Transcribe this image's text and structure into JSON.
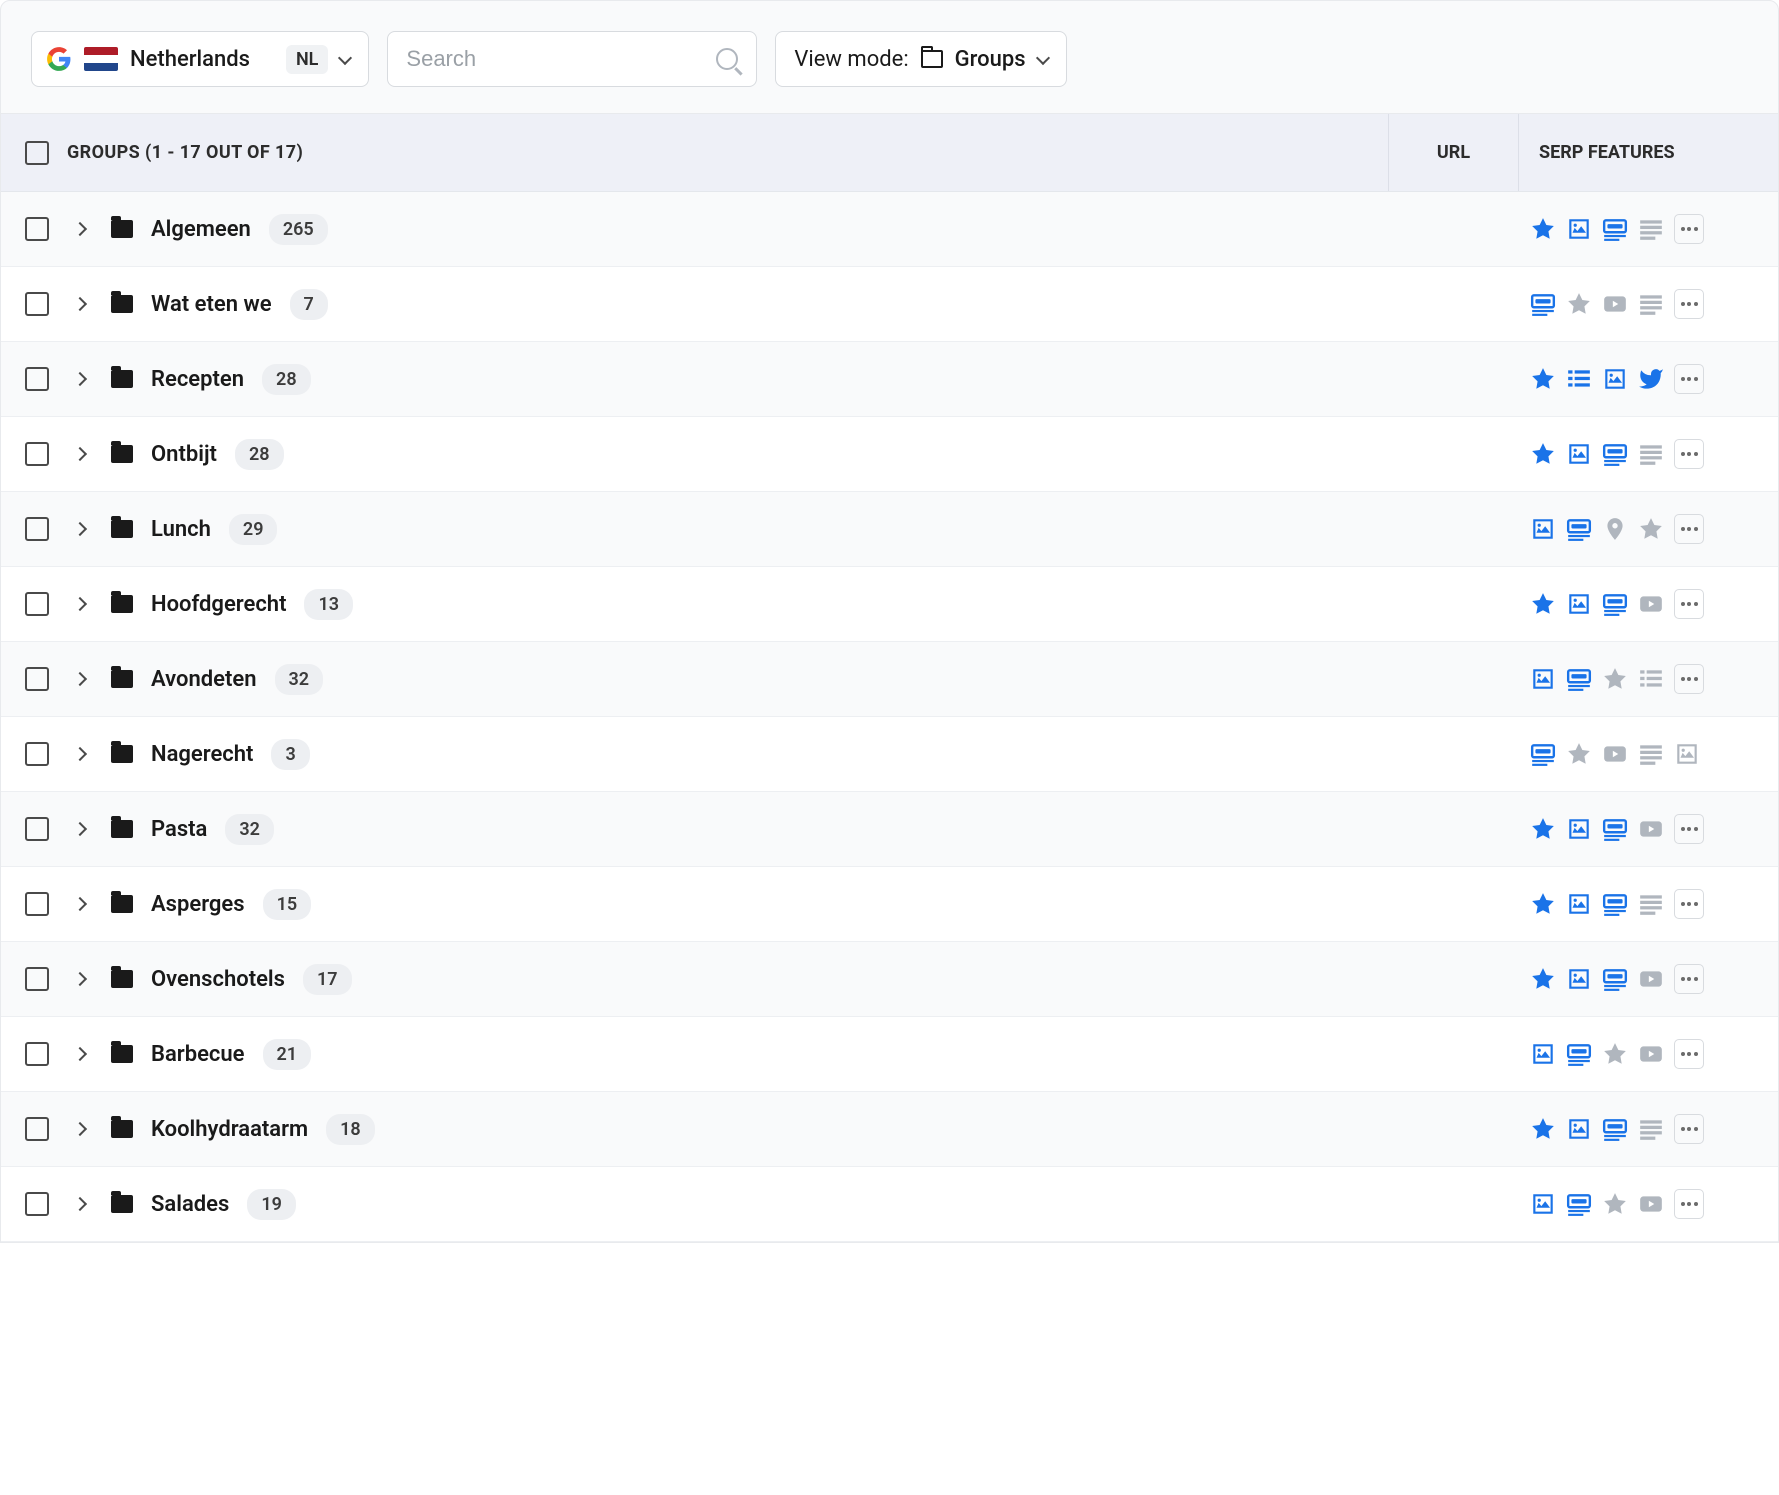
{
  "toolbar": {
    "country_name": "Netherlands",
    "country_code": "NL",
    "search_placeholder": "Search",
    "viewmode_label": "View mode:",
    "viewmode_value": "Groups"
  },
  "headers": {
    "groups": "GROUPS (1 - 17 OUT OF 17)",
    "url": "URL",
    "serp": "SERP FEATURES"
  },
  "rows": [
    {
      "name": "Algemeen",
      "count": "265",
      "features": [
        {
          "t": "star",
          "a": true
        },
        {
          "t": "image",
          "a": true
        },
        {
          "t": "card",
          "a": true
        },
        {
          "t": "lines",
          "a": false
        }
      ],
      "more": true
    },
    {
      "name": "Wat eten we",
      "count": "7",
      "features": [
        {
          "t": "card",
          "a": true
        },
        {
          "t": "star",
          "a": false
        },
        {
          "t": "video",
          "a": false
        },
        {
          "t": "lines",
          "a": false
        }
      ],
      "more": true
    },
    {
      "name": "Recepten",
      "count": "28",
      "features": [
        {
          "t": "star",
          "a": true
        },
        {
          "t": "list",
          "a": true
        },
        {
          "t": "image",
          "a": true
        },
        {
          "t": "twitter",
          "a": true
        }
      ],
      "more": true
    },
    {
      "name": "Ontbijt",
      "count": "28",
      "features": [
        {
          "t": "star",
          "a": true
        },
        {
          "t": "image",
          "a": true
        },
        {
          "t": "card",
          "a": true
        },
        {
          "t": "lines",
          "a": false
        }
      ],
      "more": true
    },
    {
      "name": "Lunch",
      "count": "29",
      "features": [
        {
          "t": "image",
          "a": true
        },
        {
          "t": "card",
          "a": true
        },
        {
          "t": "pin",
          "a": false
        },
        {
          "t": "star",
          "a": false
        }
      ],
      "more": true
    },
    {
      "name": "Hoofdgerecht",
      "count": "13",
      "features": [
        {
          "t": "star",
          "a": true
        },
        {
          "t": "image",
          "a": true
        },
        {
          "t": "card",
          "a": true
        },
        {
          "t": "video",
          "a": false
        }
      ],
      "more": true
    },
    {
      "name": "Avondeten",
      "count": "32",
      "features": [
        {
          "t": "image",
          "a": true
        },
        {
          "t": "card",
          "a": true
        },
        {
          "t": "star",
          "a": false
        },
        {
          "t": "list",
          "a": false
        }
      ],
      "more": true
    },
    {
      "name": "Nagerecht",
      "count": "3",
      "features": [
        {
          "t": "card",
          "a": true
        },
        {
          "t": "star",
          "a": false
        },
        {
          "t": "video",
          "a": false
        },
        {
          "t": "lines",
          "a": false
        },
        {
          "t": "image",
          "a": false
        }
      ],
      "more": false
    },
    {
      "name": "Pasta",
      "count": "32",
      "features": [
        {
          "t": "star",
          "a": true
        },
        {
          "t": "image",
          "a": true
        },
        {
          "t": "card",
          "a": true
        },
        {
          "t": "video",
          "a": false
        }
      ],
      "more": true
    },
    {
      "name": "Asperges",
      "count": "15",
      "features": [
        {
          "t": "star",
          "a": true
        },
        {
          "t": "image",
          "a": true
        },
        {
          "t": "card",
          "a": true
        },
        {
          "t": "lines",
          "a": false
        }
      ],
      "more": true
    },
    {
      "name": "Ovenschotels",
      "count": "17",
      "features": [
        {
          "t": "star",
          "a": true
        },
        {
          "t": "image",
          "a": true
        },
        {
          "t": "card",
          "a": true
        },
        {
          "t": "video",
          "a": false
        }
      ],
      "more": true
    },
    {
      "name": "Barbecue",
      "count": "21",
      "features": [
        {
          "t": "image",
          "a": true
        },
        {
          "t": "card",
          "a": true
        },
        {
          "t": "star",
          "a": false
        },
        {
          "t": "video",
          "a": false
        }
      ],
      "more": true
    },
    {
      "name": "Koolhydraatarm",
      "count": "18",
      "features": [
        {
          "t": "star",
          "a": true
        },
        {
          "t": "image",
          "a": true
        },
        {
          "t": "card",
          "a": true
        },
        {
          "t": "lines",
          "a": false
        }
      ],
      "more": true
    },
    {
      "name": "Salades",
      "count": "19",
      "features": [
        {
          "t": "image",
          "a": true
        },
        {
          "t": "card",
          "a": true
        },
        {
          "t": "star",
          "a": false
        },
        {
          "t": "video",
          "a": false
        }
      ],
      "more": true
    }
  ]
}
